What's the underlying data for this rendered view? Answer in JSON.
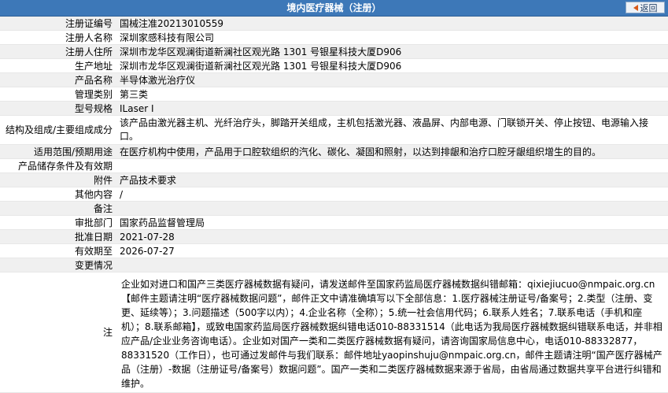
{
  "header": {
    "title": "境内医疗器械（注册）",
    "back_label": "返回"
  },
  "rows": [
    {
      "label": "注册证编号",
      "value": "国械注准20213010559"
    },
    {
      "label": "注册人名称",
      "value": "深圳家感科技有限公司"
    },
    {
      "label": "注册人住所",
      "value": "深圳市龙华区观澜街道新澜社区观光路 1301 号银星科技大厦D906"
    },
    {
      "label": "生产地址",
      "value": "深圳市龙华区观澜街道新澜社区观光路 1301 号银星科技大厦D906"
    },
    {
      "label": "产品名称",
      "value": "半导体激光治疗仪"
    },
    {
      "label": "管理类别",
      "value": "第三类"
    },
    {
      "label": "型号规格",
      "value": "ILaser I"
    },
    {
      "label": "结构及组成/主要组成成分",
      "value": "该产品由激光器主机、光纤治疗头，脚踏开关组成，主机包括激光器、液晶屏、内部电源、门联锁开关、停止按钮、电源输入接口。"
    },
    {
      "label": "适用范围/预期用途",
      "value": "在医疗机构中使用，产品用于口腔软组织的汽化、碳化、凝固和照射，以达到排龈和治疗口腔牙龈组织增生的目的。"
    },
    {
      "label": "产品储存条件及有效期",
      "value": ""
    },
    {
      "label": "附件",
      "value": "产品技术要求"
    },
    {
      "label": "其他内容",
      "value": "/"
    },
    {
      "label": "备注",
      "value": ""
    },
    {
      "label": "审批部门",
      "value": "国家药品监督管理局"
    },
    {
      "label": "批准日期",
      "value": "2021-07-28"
    },
    {
      "label": "有效期至",
      "value": "2026-07-27"
    },
    {
      "label": "变更情况",
      "value": ""
    }
  ],
  "note": {
    "label": "注",
    "text": "企业如对进口和国产三类医疗器械数据有疑问，请发送邮件至国家药监局医疗器械数据纠错邮箱：qixiejiucuo@nmpaic.org.cn【邮件主题请注明“医疗器械数据问题”，邮件正文中请准确填写以下全部信息：1.医疗器械注册证号/备案号；2.类型（注册、变更、延续等）；3.问题描述（500字以内）；4.企业名称（全称）；5.统一社会信用代码；6.联系人姓名；7.联系电话（手机和座机）；8.联系邮箱】，或致电国家药监局医疗器械数据纠错电话010-88331514（此电话为我局医疗器械数据纠错联系电话，并非相应产品/企业业务咨询电话）。企业如对国产一类和二类医疗器械数据有疑问，请咨询国家局信息中心，电话010-88332877，88331520（工作日），也可通过发邮件与我们联系：邮件地址yaopinshuju@nmpaic.org.cn，邮件主题请注明“国产医疗器械产品（注册）-数据（注册证号/备案号）数据问题”。国产一类和二类医疗器械数据来源于省局，由省局通过数据共享平台进行纠错和维护。"
  }
}
